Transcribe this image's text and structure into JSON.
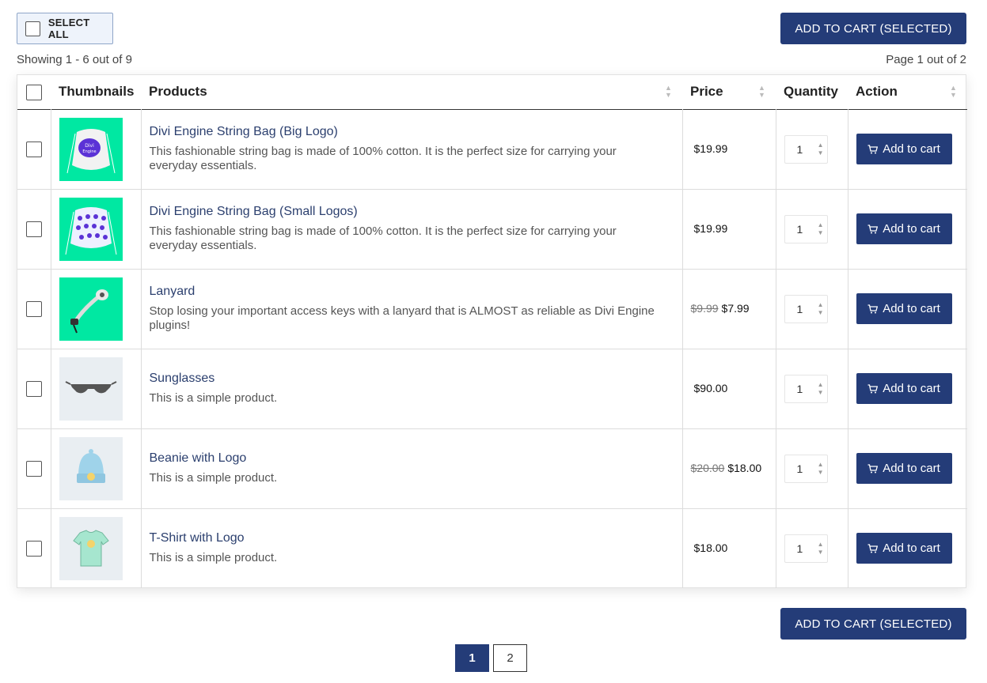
{
  "toolbar": {
    "select_all_label": "SELECT ALL",
    "add_selected_label": "ADD TO CART (SELECTED)",
    "showing": "Showing 1 - 6 out of 9",
    "page_info": "Page 1 out of 2"
  },
  "table": {
    "headers": {
      "thumbnails": "Thumbnails",
      "products": "Products",
      "price": "Price",
      "quantity": "Quantity",
      "action": "Action"
    },
    "rows": [
      {
        "name": "Divi Engine String Bag (Big Logo)",
        "description": "This fashionable string bag is made of 100% cotton. It is the perfect size for carrying your everyday essentials.",
        "old_price": "",
        "price": "$19.99",
        "qty": "1",
        "action": "Add to cart"
      },
      {
        "name": "Divi Engine String Bag (Small Logos)",
        "description": "This fashionable string bag is made of 100% cotton. It is the perfect size for carrying your everyday essentials.",
        "old_price": "",
        "price": "$19.99",
        "qty": "1",
        "action": "Add to cart"
      },
      {
        "name": "Lanyard",
        "description": "Stop losing your important access keys with a lanyard that is ALMOST as reliable as Divi Engine plugins!",
        "old_price": "$9.99",
        "price": "$7.99",
        "qty": "1",
        "action": "Add to cart"
      },
      {
        "name": "Sunglasses",
        "description": "This is a simple product.",
        "old_price": "",
        "price": "$90.00",
        "qty": "1",
        "action": "Add to cart"
      },
      {
        "name": "Beanie with Logo",
        "description": "This is a simple product.",
        "old_price": "$20.00",
        "price": "$18.00",
        "qty": "1",
        "action": "Add to cart"
      },
      {
        "name": "T-Shirt with Logo",
        "description": "This is a simple product.",
        "old_price": "",
        "price": "$18.00",
        "qty": "1",
        "action": "Add to cart"
      }
    ]
  },
  "pagination": {
    "pages": [
      "1",
      "2"
    ],
    "current": "1"
  },
  "colors": {
    "accent": "#243c78",
    "thumb_green": "#00e8a2",
    "thumb_grey": "#e9eef2"
  },
  "icons": {
    "cart": "cart-icon",
    "sort": "sort-arrows-icon",
    "spinner": "qty-spinner-icon"
  }
}
